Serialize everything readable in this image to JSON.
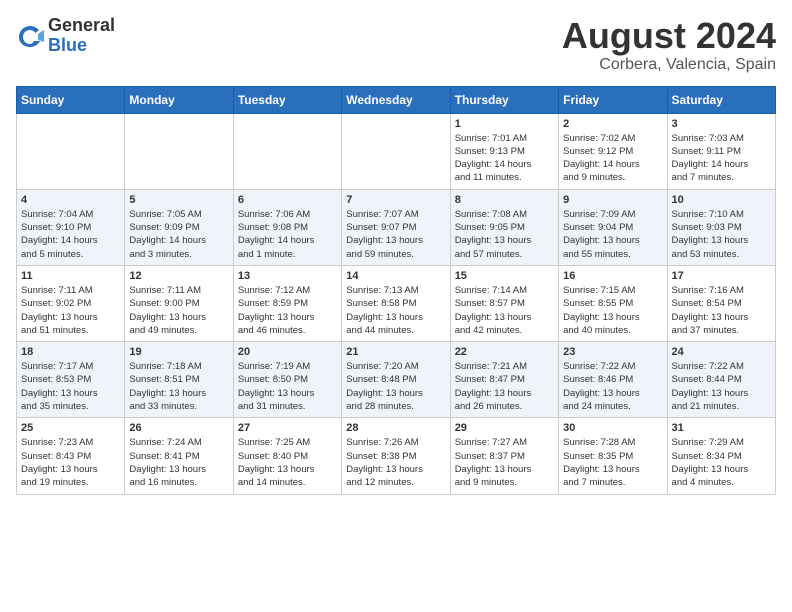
{
  "logo": {
    "general": "General",
    "blue": "Blue"
  },
  "title": "August 2024",
  "subtitle": "Corbera, Valencia, Spain",
  "days_of_week": [
    "Sunday",
    "Monday",
    "Tuesday",
    "Wednesday",
    "Thursday",
    "Friday",
    "Saturday"
  ],
  "weeks": [
    [
      {
        "day": "",
        "info": ""
      },
      {
        "day": "",
        "info": ""
      },
      {
        "day": "",
        "info": ""
      },
      {
        "day": "",
        "info": ""
      },
      {
        "day": "1",
        "info": "Sunrise: 7:01 AM\nSunset: 9:13 PM\nDaylight: 14 hours\nand 11 minutes."
      },
      {
        "day": "2",
        "info": "Sunrise: 7:02 AM\nSunset: 9:12 PM\nDaylight: 14 hours\nand 9 minutes."
      },
      {
        "day": "3",
        "info": "Sunrise: 7:03 AM\nSunset: 9:11 PM\nDaylight: 14 hours\nand 7 minutes."
      }
    ],
    [
      {
        "day": "4",
        "info": "Sunrise: 7:04 AM\nSunset: 9:10 PM\nDaylight: 14 hours\nand 5 minutes."
      },
      {
        "day": "5",
        "info": "Sunrise: 7:05 AM\nSunset: 9:09 PM\nDaylight: 14 hours\nand 3 minutes."
      },
      {
        "day": "6",
        "info": "Sunrise: 7:06 AM\nSunset: 9:08 PM\nDaylight: 14 hours\nand 1 minute."
      },
      {
        "day": "7",
        "info": "Sunrise: 7:07 AM\nSunset: 9:07 PM\nDaylight: 13 hours\nand 59 minutes."
      },
      {
        "day": "8",
        "info": "Sunrise: 7:08 AM\nSunset: 9:05 PM\nDaylight: 13 hours\nand 57 minutes."
      },
      {
        "day": "9",
        "info": "Sunrise: 7:09 AM\nSunset: 9:04 PM\nDaylight: 13 hours\nand 55 minutes."
      },
      {
        "day": "10",
        "info": "Sunrise: 7:10 AM\nSunset: 9:03 PM\nDaylight: 13 hours\nand 53 minutes."
      }
    ],
    [
      {
        "day": "11",
        "info": "Sunrise: 7:11 AM\nSunset: 9:02 PM\nDaylight: 13 hours\nand 51 minutes."
      },
      {
        "day": "12",
        "info": "Sunrise: 7:11 AM\nSunset: 9:00 PM\nDaylight: 13 hours\nand 49 minutes."
      },
      {
        "day": "13",
        "info": "Sunrise: 7:12 AM\nSunset: 8:59 PM\nDaylight: 13 hours\nand 46 minutes."
      },
      {
        "day": "14",
        "info": "Sunrise: 7:13 AM\nSunset: 8:58 PM\nDaylight: 13 hours\nand 44 minutes."
      },
      {
        "day": "15",
        "info": "Sunrise: 7:14 AM\nSunset: 8:57 PM\nDaylight: 13 hours\nand 42 minutes."
      },
      {
        "day": "16",
        "info": "Sunrise: 7:15 AM\nSunset: 8:55 PM\nDaylight: 13 hours\nand 40 minutes."
      },
      {
        "day": "17",
        "info": "Sunrise: 7:16 AM\nSunset: 8:54 PM\nDaylight: 13 hours\nand 37 minutes."
      }
    ],
    [
      {
        "day": "18",
        "info": "Sunrise: 7:17 AM\nSunset: 8:53 PM\nDaylight: 13 hours\nand 35 minutes."
      },
      {
        "day": "19",
        "info": "Sunrise: 7:18 AM\nSunset: 8:51 PM\nDaylight: 13 hours\nand 33 minutes."
      },
      {
        "day": "20",
        "info": "Sunrise: 7:19 AM\nSunset: 8:50 PM\nDaylight: 13 hours\nand 31 minutes."
      },
      {
        "day": "21",
        "info": "Sunrise: 7:20 AM\nSunset: 8:48 PM\nDaylight: 13 hours\nand 28 minutes."
      },
      {
        "day": "22",
        "info": "Sunrise: 7:21 AM\nSunset: 8:47 PM\nDaylight: 13 hours\nand 26 minutes."
      },
      {
        "day": "23",
        "info": "Sunrise: 7:22 AM\nSunset: 8:46 PM\nDaylight: 13 hours\nand 24 minutes."
      },
      {
        "day": "24",
        "info": "Sunrise: 7:22 AM\nSunset: 8:44 PM\nDaylight: 13 hours\nand 21 minutes."
      }
    ],
    [
      {
        "day": "25",
        "info": "Sunrise: 7:23 AM\nSunset: 8:43 PM\nDaylight: 13 hours\nand 19 minutes."
      },
      {
        "day": "26",
        "info": "Sunrise: 7:24 AM\nSunset: 8:41 PM\nDaylight: 13 hours\nand 16 minutes."
      },
      {
        "day": "27",
        "info": "Sunrise: 7:25 AM\nSunset: 8:40 PM\nDaylight: 13 hours\nand 14 minutes."
      },
      {
        "day": "28",
        "info": "Sunrise: 7:26 AM\nSunset: 8:38 PM\nDaylight: 13 hours\nand 12 minutes."
      },
      {
        "day": "29",
        "info": "Sunrise: 7:27 AM\nSunset: 8:37 PM\nDaylight: 13 hours\nand 9 minutes."
      },
      {
        "day": "30",
        "info": "Sunrise: 7:28 AM\nSunset: 8:35 PM\nDaylight: 13 hours\nand 7 minutes."
      },
      {
        "day": "31",
        "info": "Sunrise: 7:29 AM\nSunset: 8:34 PM\nDaylight: 13 hours\nand 4 minutes."
      }
    ]
  ]
}
